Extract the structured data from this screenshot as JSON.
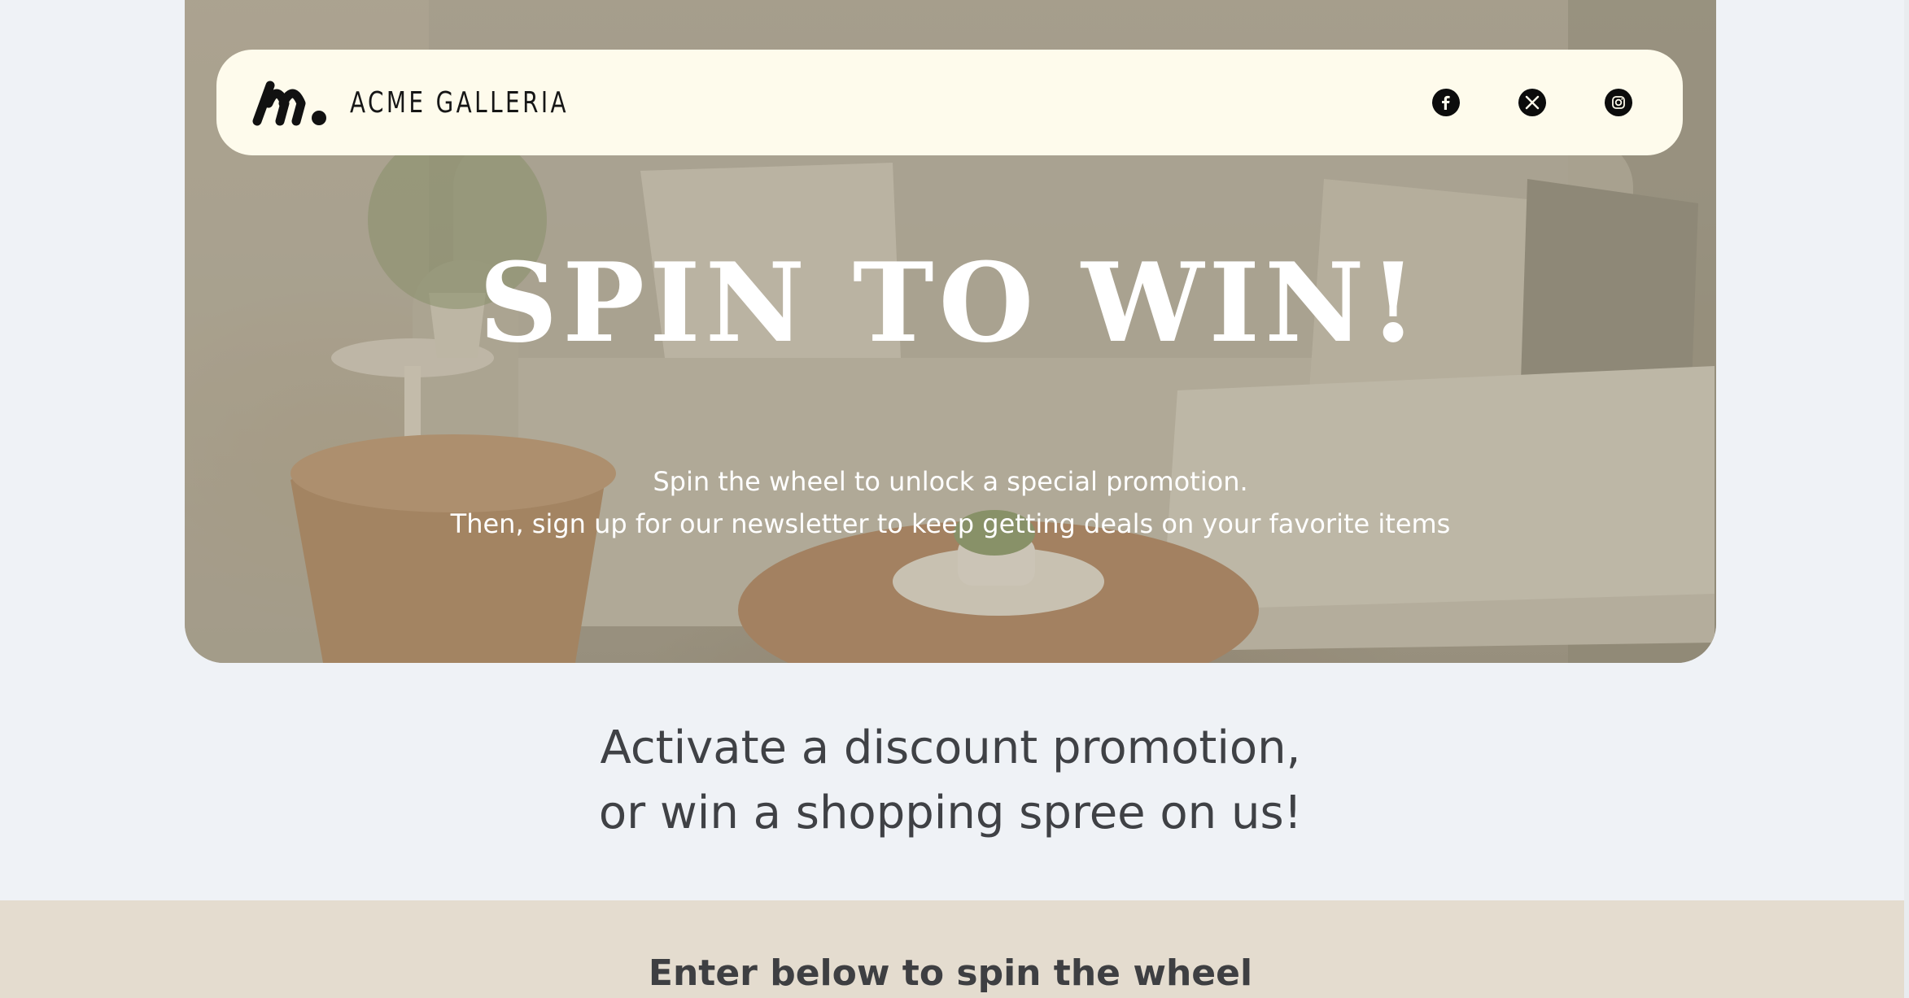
{
  "brand": {
    "name": "ACME GALLERIA",
    "logo_icon": "acme-m-logo-icon"
  },
  "nav": {
    "socials": [
      {
        "name": "facebook",
        "icon": "facebook-icon",
        "glyph": "f"
      },
      {
        "name": "x",
        "icon": "x-icon",
        "glyph": "𝕏"
      },
      {
        "name": "instagram",
        "icon": "instagram-icon",
        "glyph": ""
      }
    ]
  },
  "hero": {
    "title": "SPIN TO WIN!",
    "subtitle_line1": "Spin the wheel to unlock a special promotion.",
    "subtitle_line2": "Then, sign up for our newsletter to keep getting deals on your favorite items"
  },
  "promo": {
    "line1": "Activate a discount promotion,",
    "line2": "or win a shopping spree on us!"
  },
  "entry": {
    "title": "Enter below to spin the wheel"
  },
  "colors": {
    "page_bg": "#eff2f6",
    "nav_bg": "#fefbec",
    "band_bg": "#e4dccf",
    "heading_text": "#3f4145",
    "hero_text": "#ffffff"
  }
}
